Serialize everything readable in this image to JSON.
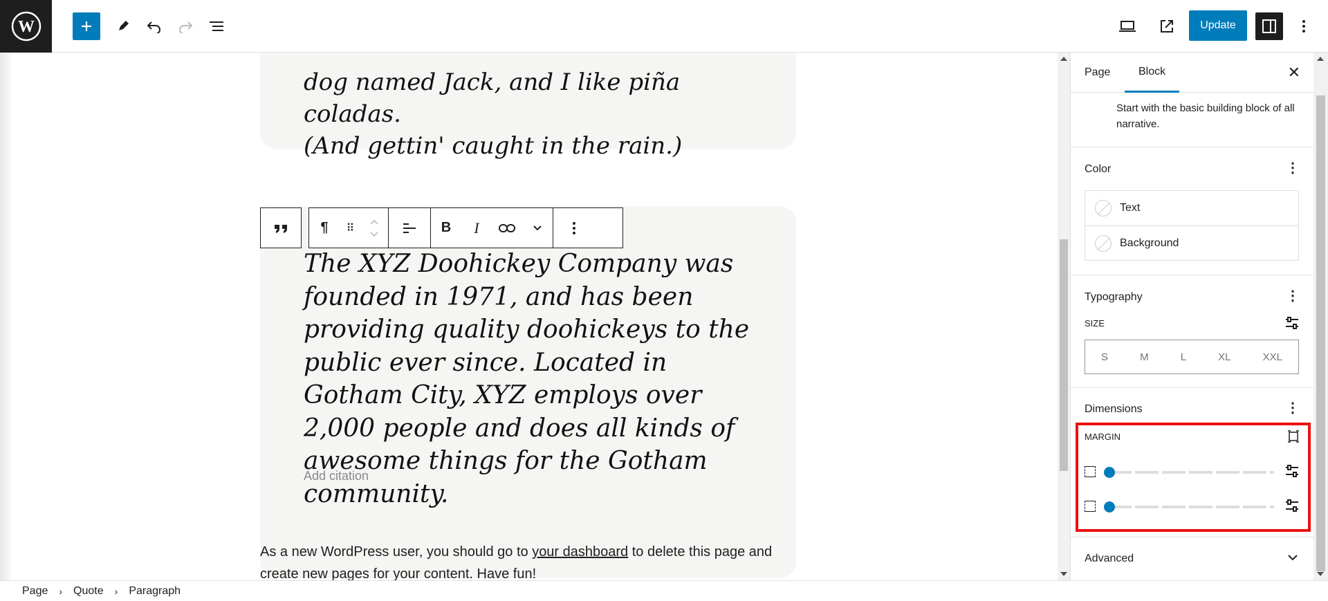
{
  "toolbar": {
    "update_label": "Update",
    "icons": [
      "wordpress-logo",
      "plus-icon",
      "pencil-icon",
      "undo-icon",
      "redo-icon",
      "list-view-icon",
      "desktop-preview-icon",
      "external-view-icon",
      "settings-icon",
      "options-icon"
    ]
  },
  "canvas": {
    "top_quote": [
      "dog named Jack, and I like piña coladas.",
      "(And gettin' caught in the rain.)"
    ],
    "main_quote": "The XYZ Doohickey Company was founded in 1971, and has been providing quality doohickeys to the public ever since. Located in Gotham City, XYZ employs over 2,000 people and does all kinds of awesome things for the Gotham community.",
    "citation_placeholder": "Add citation",
    "paragraph_before": "As a new WordPress user, you should go to ",
    "paragraph_link": "your dashboard",
    "paragraph_after": " to delete this page and create new pages for your content. Have fun!"
  },
  "sidebar": {
    "tabs": [
      "Page",
      "Block"
    ],
    "active_tab": "Block",
    "description": "Start with the basic building block of all narrative.",
    "color": {
      "title": "Color",
      "items": [
        "Text",
        "Background"
      ]
    },
    "typography": {
      "title": "Typography",
      "size_label": "SIZE",
      "sizes": [
        "S",
        "M",
        "L",
        "XL",
        "XXL"
      ]
    },
    "dimensions": {
      "title": "Dimensions",
      "margin_label": "MARGIN",
      "margin_top_value": 0,
      "margin_bottom_value": 0
    },
    "advanced": {
      "title": "Advanced"
    }
  },
  "breadcrumb": [
    "Page",
    "Quote",
    "Paragraph"
  ],
  "colors": {
    "accent": "#007cba",
    "dark": "#1e1e1e",
    "highlight": "#ee1111"
  }
}
